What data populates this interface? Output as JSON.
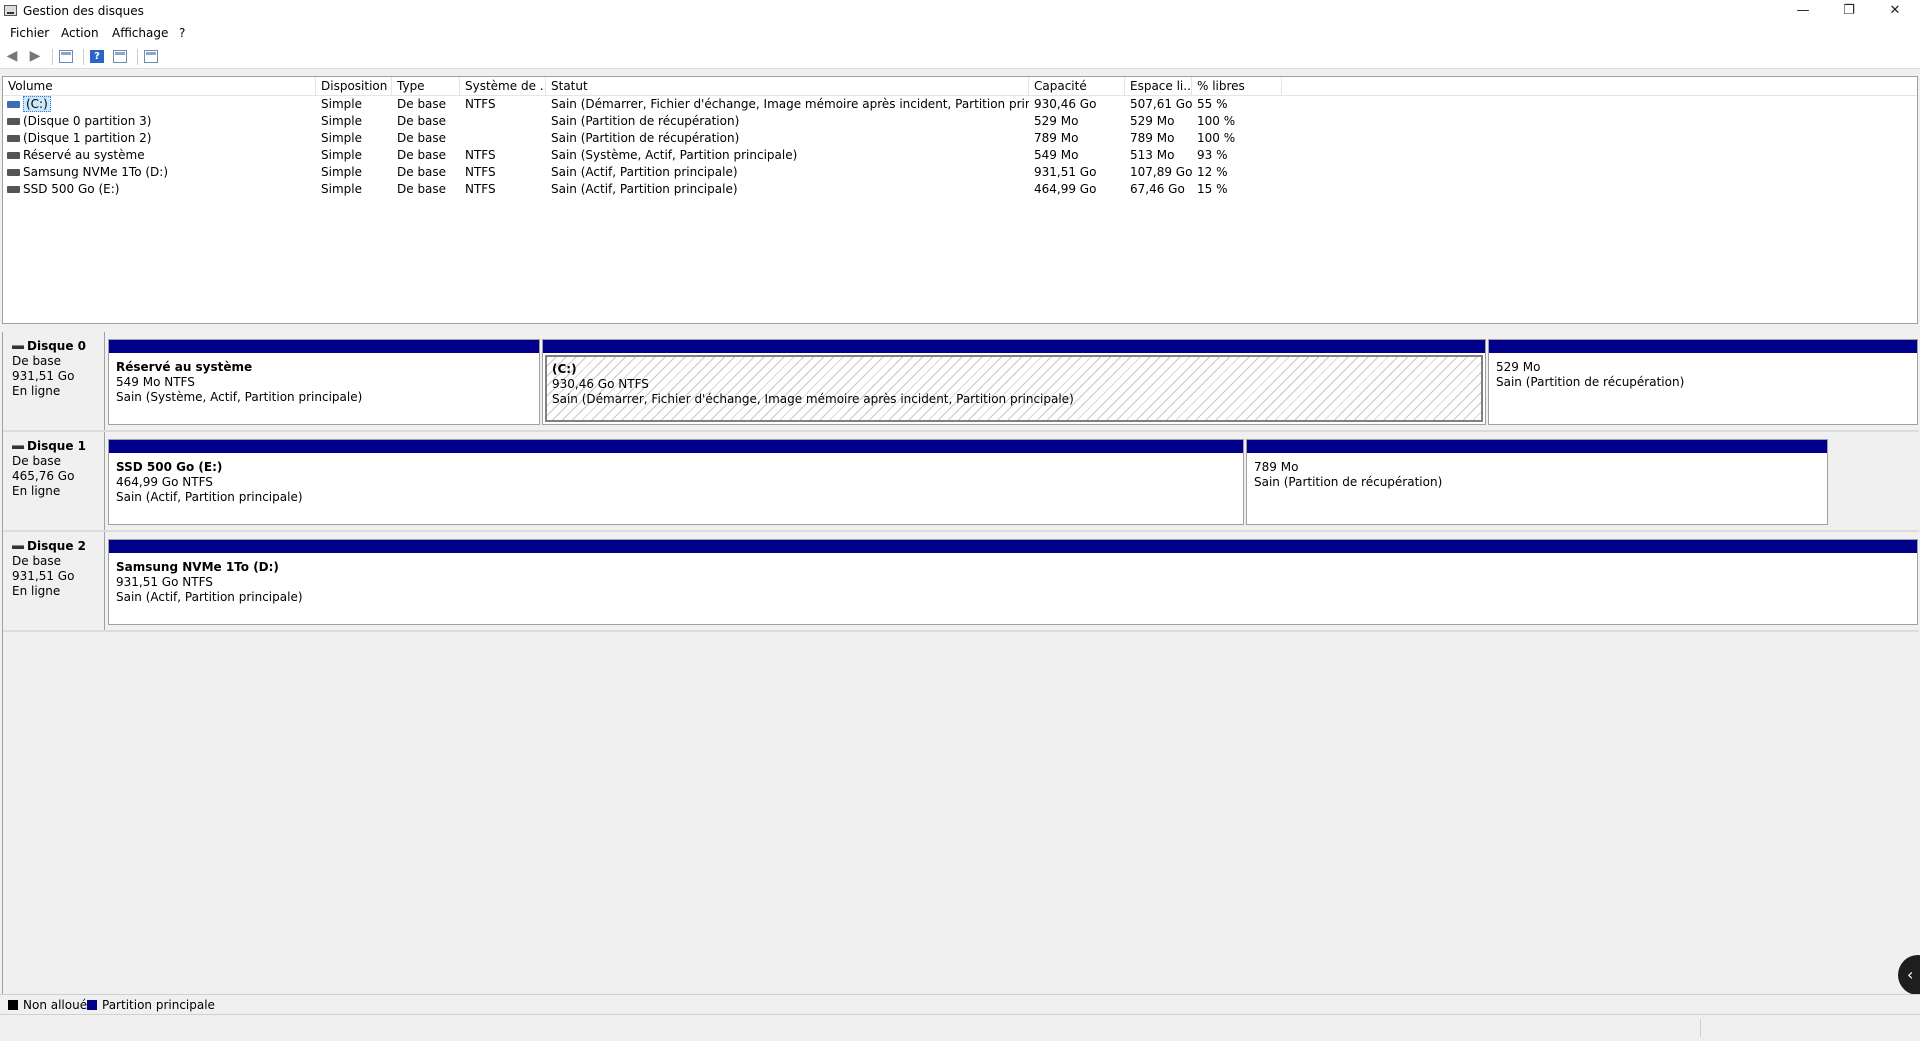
{
  "window": {
    "title": "Gestion des disques",
    "minimize": "—",
    "restore": "❐",
    "close": "✕"
  },
  "menu": [
    "Fichier",
    "Action",
    "Affichage",
    "?"
  ],
  "toolbar": {
    "back": "◀",
    "forward": "▶",
    "help": "?"
  },
  "volume_table": {
    "columns": [
      "Volume",
      "Disposition",
      "Type",
      "Système de ...",
      "Statut",
      "Capacité",
      "Espace li...",
      "% libres"
    ],
    "rows": [
      [
        "(C:)",
        "Simple",
        "De base",
        "NTFS",
        "Sain (Démarrer, Fichier d'échange, Image mémoire après incident, Partition principale)",
        "930,46 Go",
        "507,61 Go",
        "55 %"
      ],
      [
        "(Disque 0 partition 3)",
        "Simple",
        "De base",
        "",
        "Sain (Partition de récupération)",
        "529 Mo",
        "529 Mo",
        "100 %"
      ],
      [
        "(Disque 1 partition 2)",
        "Simple",
        "De base",
        "",
        "Sain (Partition de récupération)",
        "789 Mo",
        "789 Mo",
        "100 %"
      ],
      [
        "Réservé au système",
        "Simple",
        "De base",
        "NTFS",
        "Sain (Système, Actif, Partition principale)",
        "549 Mo",
        "513 Mo",
        "93 %"
      ],
      [
        "Samsung NVMe 1To (D:)",
        "Simple",
        "De base",
        "NTFS",
        "Sain (Actif, Partition principale)",
        "931,51 Go",
        "107,89 Go",
        "12 %"
      ],
      [
        "SSD 500 Go (E:)",
        "Simple",
        "De base",
        "NTFS",
        "Sain (Actif, Partition principale)",
        "464,99 Go",
        "67,46 Go",
        "15 %"
      ]
    ]
  },
  "disks": [
    {
      "name": "Disque 0",
      "type": "De base",
      "size": "931,51 Go",
      "state": "En ligne",
      "partitions": [
        {
          "name": "Réservé au système",
          "size": "549 Mo NTFS",
          "status": "Sain (Système, Actif, Partition principale)"
        },
        {
          "name": "(C:)",
          "size": "930,46 Go NTFS",
          "status": "Sain (Démarrer, Fichier d'échange, Image mémoire après incident, Partition principale)"
        },
        {
          "name": "",
          "size": "529 Mo",
          "status": "Sain (Partition de récupération)"
        }
      ]
    },
    {
      "name": "Disque 1",
      "type": "De base",
      "size": "465,76 Go",
      "state": "En ligne",
      "partitions": [
        {
          "name": "SSD 500 Go  (E:)",
          "size": "464,99 Go NTFS",
          "status": "Sain (Actif, Partition principale)"
        },
        {
          "name": "",
          "size": "789 Mo",
          "status": "Sain (Partition de récupération)"
        }
      ]
    },
    {
      "name": "Disque 2",
      "type": "De base",
      "size": "931,51 Go",
      "state": "En ligne",
      "partitions": [
        {
          "name": "Samsung NVMe 1To  (D:)",
          "size": "931,51 Go NTFS",
          "status": "Sain (Actif, Partition principale)"
        }
      ]
    }
  ],
  "legend": {
    "unallocated": "Non alloué",
    "primary": "Partition principale",
    "unallocated_color": "#000000",
    "primary_color": "#00008b"
  },
  "handle": "‹"
}
